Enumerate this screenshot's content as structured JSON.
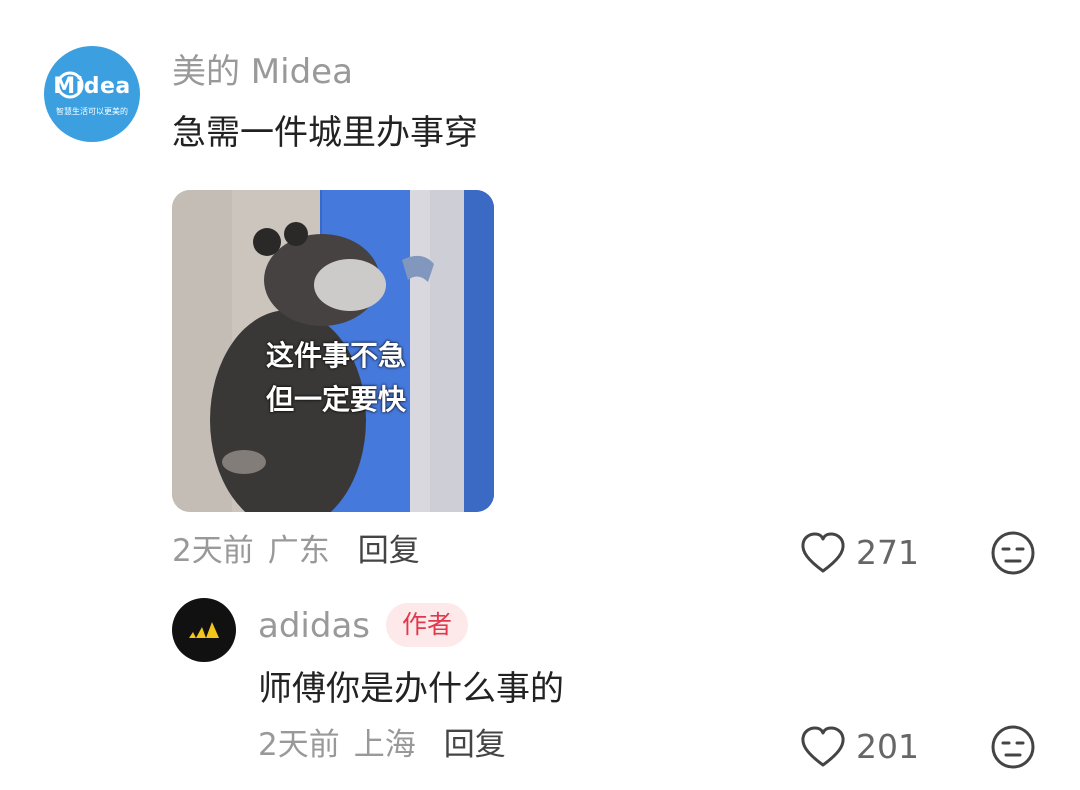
{
  "comment": {
    "avatar": {
      "brand": "Midea",
      "slogan": "智慧生活可以更美的",
      "color": "#3ca0e0"
    },
    "username": "美的 Midea",
    "text": "急需一件城里办事穿",
    "sticker": {
      "caption_line1": "这件事不急",
      "caption_line2": "但一定要快"
    },
    "time": "2天前",
    "location": "广东",
    "reply_label": "回复",
    "likes": "271"
  },
  "reply": {
    "username": "adidas",
    "badge": "作者",
    "badge_color": "#e0394d",
    "text": "师傅你是办什么事的",
    "time": "2天前",
    "location": "上海",
    "reply_label": "回复",
    "likes": "201"
  },
  "icons": {
    "like": "heart-outline-icon",
    "dislike": "dislike-face-icon"
  }
}
